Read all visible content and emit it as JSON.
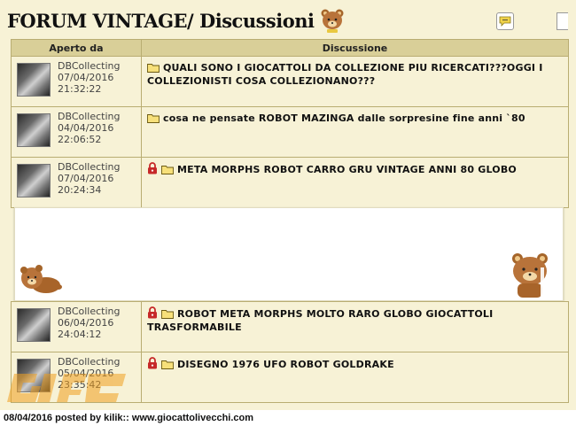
{
  "header": {
    "title": "FORUM VINTAGE/ Discussioni",
    "bear_icon": "teddy-bear-icon",
    "chat_icon": "speech-bubble-icon"
  },
  "table": {
    "columns": [
      "Aperto da",
      "Discussione"
    ],
    "rows": [
      {
        "author": "DBCollecting",
        "date": "07/04/2016",
        "time": "21:32:22",
        "locked": false,
        "topic": "QUALI SONO I GIOCATTOLI DA COLLEZIONE PIU RICERCATI???OGGI I COLLEZIONISTI COSA COLLEZIONANO???"
      },
      {
        "author": "DBCollecting",
        "date": "04/04/2016",
        "time": "22:06:52",
        "locked": false,
        "topic": "cosa ne pensate ROBOT MAZINGA dalle sorpresine fine anni `80"
      },
      {
        "author": "DBCollecting",
        "date": "07/04/2016",
        "time": "20:24:34",
        "locked": true,
        "topic": "META MORPHS ROBOT CARRO GRU VINTAGE ANNI 80 GLOBO"
      },
      {
        "author": "DBCollecting",
        "date": "06/04/2016",
        "time": "24:04:12",
        "locked": true,
        "topic": "ROBOT META MORPHS MOLTO RARO GLOBO GIOCATTOLI TRASFORMABILE"
      },
      {
        "author": "DBCollecting",
        "date": "05/04/2016",
        "time": "23:35:42",
        "locked": true,
        "topic": "DISEGNO 1976 UFO ROBOT GOLDRAKE"
      }
    ]
  },
  "footer": {
    "caption": "08/04/2016 posted by kilik:: www.giocattolivecchi.com"
  },
  "colors": {
    "background": "#f7f2d6",
    "header_row": "#d9cf98",
    "border": "#b9ad72",
    "lock": "#c62828",
    "folder": "#f4d64a"
  }
}
